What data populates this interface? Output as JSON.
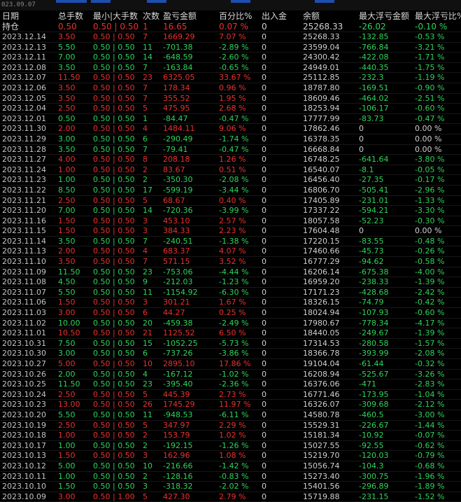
{
  "app": {
    "top_date": "023.09.07",
    "colors": {
      "up": "#e8322e",
      "down": "#2fd35a",
      "neutral": "#d0d0d0",
      "background": "#000000"
    }
  },
  "headers": [
    "日期",
    "总手数",
    "最小|大手数",
    "次数",
    "盈亏金额",
    "百分比%",
    "出入金",
    "余额",
    "最大浮亏金额",
    "最大浮亏比%"
  ],
  "holding": {
    "label": "持仓",
    "total": "0.50",
    "minmax": "0.50 | 0.50",
    "count": "1",
    "pnl": "16.65",
    "pct": "0.07 %",
    "flow": "0",
    "balance": "25268.33",
    "maxloss": "-26.02",
    "maxlosspct": "-0.10 %",
    "tone": "red"
  },
  "rows": [
    {
      "date": "2023.12.14",
      "total": "3.50",
      "minmax": "0.50 | 0.50",
      "count": "7",
      "pnl": "1669.29",
      "pct": "7.07 %",
      "flow": "0",
      "balance": "25268.33",
      "maxloss": "-132.85",
      "maxlosspct": "-0.53 %",
      "tone": "red"
    },
    {
      "date": "2023.12.13",
      "total": "5.50",
      "minmax": "0.50 | 0.50",
      "count": "11",
      "pnl": "-701.38",
      "pct": "-2.89 %",
      "flow": "0",
      "balance": "23599.04",
      "maxloss": "-766.84",
      "maxlosspct": "-3.21 %",
      "tone": "green"
    },
    {
      "date": "2023.12.11",
      "total": "7.00",
      "minmax": "0.50 | 0.50",
      "count": "14",
      "pnl": "-648.59",
      "pct": "-2.60 %",
      "flow": "0",
      "balance": "24300.42",
      "maxloss": "-422.08",
      "maxlosspct": "-1.71 %",
      "tone": "green"
    },
    {
      "date": "2023.12.08",
      "total": "3.50",
      "minmax": "0.50 | 0.50",
      "count": "7",
      "pnl": "-163.84",
      "pct": "-0.65 %",
      "flow": "0",
      "balance": "24949.01",
      "maxloss": "-440.35",
      "maxlosspct": "-1.75 %",
      "tone": "green"
    },
    {
      "date": "2023.12.07",
      "total": "11.50",
      "minmax": "0.50 | 0.50",
      "count": "23",
      "pnl": "6325.05",
      "pct": "33.67 %",
      "flow": "0",
      "balance": "25112.85",
      "maxloss": "-232.3",
      "maxlosspct": "-1.19 %",
      "tone": "red"
    },
    {
      "date": "2023.12.06",
      "total": "3.50",
      "minmax": "0.50 | 0.50",
      "count": "7",
      "pnl": "178.34",
      "pct": "0.96 %",
      "flow": "0",
      "balance": "18787.80",
      "maxloss": "-169.51",
      "maxlosspct": "-0.90 %",
      "tone": "red"
    },
    {
      "date": "2023.12.05",
      "total": "3.50",
      "minmax": "0.50 | 0.50",
      "count": "7",
      "pnl": "355.52",
      "pct": "1.95 %",
      "flow": "0",
      "balance": "18609.46",
      "maxloss": "-464.02",
      "maxlosspct": "-2.51 %",
      "tone": "red"
    },
    {
      "date": "2023.12.04",
      "total": "2.50",
      "minmax": "0.50 | 0.50",
      "count": "5",
      "pnl": "475.95",
      "pct": "2.68 %",
      "flow": "0",
      "balance": "18253.94",
      "maxloss": "-106.17",
      "maxlosspct": "-0.60 %",
      "tone": "red"
    },
    {
      "date": "2023.12.01",
      "total": "0.50",
      "minmax": "0.50 | 0.50",
      "count": "1",
      "pnl": "-84.47",
      "pct": "-0.47 %",
      "flow": "0",
      "balance": "17777.99",
      "maxloss": "-83.73",
      "maxlosspct": "-0.47 %",
      "tone": "green"
    },
    {
      "date": "2023.11.30",
      "total": "2.00",
      "minmax": "0.50 | 0.50",
      "count": "4",
      "pnl": "1484.11",
      "pct": "9.06 %",
      "flow": "0",
      "balance": "17862.46",
      "maxloss": "0",
      "maxlosspct": "0.00 %",
      "tone": "red"
    },
    {
      "date": "2023.11.29",
      "total": "3.00",
      "minmax": "0.50 | 0.50",
      "count": "6",
      "pnl": "-290.49",
      "pct": "-1.74 %",
      "flow": "0",
      "balance": "16378.35",
      "maxloss": "0",
      "maxlosspct": "0.00 %",
      "tone": "green"
    },
    {
      "date": "2023.11.28",
      "total": "3.50",
      "minmax": "0.50 | 0.50",
      "count": "7",
      "pnl": "-79.41",
      "pct": "-0.47 %",
      "flow": "0",
      "balance": "16668.84",
      "maxloss": "0",
      "maxlosspct": "0.00 %",
      "tone": "green"
    },
    {
      "date": "2023.11.27",
      "total": "4.00",
      "minmax": "0.50 | 0.50",
      "count": "8",
      "pnl": "208.18",
      "pct": "1.26 %",
      "flow": "0",
      "balance": "16748.25",
      "maxloss": "-641.64",
      "maxlosspct": "-3.80 %",
      "tone": "red"
    },
    {
      "date": "2023.11.24",
      "total": "1.00",
      "minmax": "0.50 | 0.50",
      "count": "2",
      "pnl": "83.67",
      "pct": "0.51 %",
      "flow": "0",
      "balance": "16540.07",
      "maxloss": "-8.1",
      "maxlosspct": "-0.05 %",
      "tone": "red"
    },
    {
      "date": "2023.11.23",
      "total": "1.00",
      "minmax": "0.50 | 0.50",
      "count": "2",
      "pnl": "-350.30",
      "pct": "-2.08 %",
      "flow": "0",
      "balance": "16456.40",
      "maxloss": "-27.35",
      "maxlosspct": "-0.17 %",
      "tone": "green"
    },
    {
      "date": "2023.11.22",
      "total": "8.50",
      "minmax": "0.50 | 0.50",
      "count": "17",
      "pnl": "-599.19",
      "pct": "-3.44 %",
      "flow": "0",
      "balance": "16806.70",
      "maxloss": "-505.41",
      "maxlosspct": "-2.96 %",
      "tone": "green"
    },
    {
      "date": "2023.11.21",
      "total": "2.50",
      "minmax": "0.50 | 0.50",
      "count": "5",
      "pnl": "68.67",
      "pct": "0.40 %",
      "flow": "0",
      "balance": "17405.89",
      "maxloss": "-231.01",
      "maxlosspct": "-1.33 %",
      "tone": "red"
    },
    {
      "date": "2023.11.20",
      "total": "7.00",
      "minmax": "0.50 | 0.50",
      "count": "14",
      "pnl": "-720.36",
      "pct": "-3.99 %",
      "flow": "0",
      "balance": "17337.22",
      "maxloss": "-594.21",
      "maxlosspct": "-3.30 %",
      "tone": "green"
    },
    {
      "date": "2023.11.16",
      "total": "1.50",
      "minmax": "0.50 | 0.50",
      "count": "3",
      "pnl": "453.10",
      "pct": "2.57 %",
      "flow": "0",
      "balance": "18057.58",
      "maxloss": "-52.23",
      "maxlosspct": "-0.30 %",
      "tone": "red"
    },
    {
      "date": "2023.11.15",
      "total": "1.50",
      "minmax": "0.50 | 0.50",
      "count": "3",
      "pnl": "384.33",
      "pct": "2.23 %",
      "flow": "0",
      "balance": "17604.48",
      "maxloss": "0",
      "maxlosspct": "0.00 %",
      "tone": "red"
    },
    {
      "date": "2023.11.14",
      "total": "3.50",
      "minmax": "0.50 | 0.50",
      "count": "7",
      "pnl": "-240.51",
      "pct": "-1.38 %",
      "flow": "0",
      "balance": "17220.15",
      "maxloss": "-83.55",
      "maxlosspct": "-0.48 %",
      "tone": "green"
    },
    {
      "date": "2023.11.13",
      "total": "2.00",
      "minmax": "0.50 | 0.50",
      "count": "4",
      "pnl": "683.37",
      "pct": "4.07 %",
      "flow": "0",
      "balance": "17460.66",
      "maxloss": "-45.73",
      "maxlosspct": "-0.26 %",
      "tone": "red"
    },
    {
      "date": "2023.11.10",
      "total": "3.50",
      "minmax": "0.50 | 0.50",
      "count": "7",
      "pnl": "571.15",
      "pct": "3.52 %",
      "flow": "0",
      "balance": "16777.29",
      "maxloss": "-94.62",
      "maxlosspct": "-0.58 %",
      "tone": "red"
    },
    {
      "date": "2023.11.09",
      "total": "11.50",
      "minmax": "0.50 | 0.50",
      "count": "23",
      "pnl": "-753.06",
      "pct": "-4.44 %",
      "flow": "0",
      "balance": "16206.14",
      "maxloss": "-675.38",
      "maxlosspct": "-4.00 %",
      "tone": "green"
    },
    {
      "date": "2023.11.08",
      "total": "4.50",
      "minmax": "0.50 | 0.50",
      "count": "9",
      "pnl": "-212.03",
      "pct": "-1.23 %",
      "flow": "0",
      "balance": "16959.20",
      "maxloss": "-238.33",
      "maxlosspct": "-1.39 %",
      "tone": "green"
    },
    {
      "date": "2023.11.07",
      "total": "5.50",
      "minmax": "0.50 | 0.50",
      "count": "11",
      "pnl": "-1154.92",
      "pct": "-6.30 %",
      "flow": "0",
      "balance": "17171.23",
      "maxloss": "-428.68",
      "maxlosspct": "-2.42 %",
      "tone": "green"
    },
    {
      "date": "2023.11.06",
      "total": "1.50",
      "minmax": "0.50 | 0.50",
      "count": "3",
      "pnl": "301.21",
      "pct": "1.67 %",
      "flow": "0",
      "balance": "18326.15",
      "maxloss": "-74.79",
      "maxlosspct": "-0.42 %",
      "tone": "red"
    },
    {
      "date": "2023.11.03",
      "total": "3.00",
      "minmax": "0.50 | 0.50",
      "count": "6",
      "pnl": "44.27",
      "pct": "0.25 %",
      "flow": "0",
      "balance": "18024.94",
      "maxloss": "-107.93",
      "maxlosspct": "-0.60 %",
      "tone": "red"
    },
    {
      "date": "2023.11.02",
      "total": "10.00",
      "minmax": "0.50 | 0.50",
      "count": "20",
      "pnl": "-459.38",
      "pct": "-2.49 %",
      "flow": "0",
      "balance": "17980.67",
      "maxloss": "-778.34",
      "maxlosspct": "-4.17 %",
      "tone": "green"
    },
    {
      "date": "2023.11.01",
      "total": "10.50",
      "minmax": "0.50 | 0.50",
      "count": "21",
      "pnl": "1125.52",
      "pct": "6.50 %",
      "flow": "0",
      "balance": "18440.05",
      "maxloss": "-249.67",
      "maxlosspct": "-1.39 %",
      "tone": "red"
    },
    {
      "date": "2023.10.31",
      "total": "7.50",
      "minmax": "0.50 | 0.50",
      "count": "15",
      "pnl": "-1052.25",
      "pct": "-5.73 %",
      "flow": "0",
      "balance": "17314.53",
      "maxloss": "-280.58",
      "maxlosspct": "-1.57 %",
      "tone": "green"
    },
    {
      "date": "2023.10.30",
      "total": "3.00",
      "minmax": "0.50 | 0.50",
      "count": "6",
      "pnl": "-737.26",
      "pct": "-3.86 %",
      "flow": "0",
      "balance": "18366.78",
      "maxloss": "-393.99",
      "maxlosspct": "-2.08 %",
      "tone": "green"
    },
    {
      "date": "2023.10.27",
      "total": "5.00",
      "minmax": "0.50 | 0.50",
      "count": "10",
      "pnl": "2895.10",
      "pct": "17.86 %",
      "flow": "0",
      "balance": "19104.04",
      "maxloss": "-61.44",
      "maxlosspct": "-0.32 %",
      "tone": "red"
    },
    {
      "date": "2023.10.26",
      "total": "2.00",
      "minmax": "0.50 | 0.50",
      "count": "4",
      "pnl": "-167.12",
      "pct": "-1.02 %",
      "flow": "0",
      "balance": "16208.94",
      "maxloss": "-525.67",
      "maxlosspct": "-3.26 %",
      "tone": "green"
    },
    {
      "date": "2023.10.25",
      "total": "11.50",
      "minmax": "0.50 | 0.50",
      "count": "23",
      "pnl": "-395.40",
      "pct": "-2.36 %",
      "flow": "0",
      "balance": "16376.06",
      "maxloss": "-471",
      "maxlosspct": "-2.83 %",
      "tone": "green"
    },
    {
      "date": "2023.10.24",
      "total": "2.50",
      "minmax": "0.50 | 0.50",
      "count": "5",
      "pnl": "445.39",
      "pct": "2.73 %",
      "flow": "0",
      "balance": "16771.46",
      "maxloss": "-173.95",
      "maxlosspct": "-1.04 %",
      "tone": "red"
    },
    {
      "date": "2023.10.23",
      "total": "13.00",
      "minmax": "0.50 | 0.50",
      "count": "26",
      "pnl": "1745.29",
      "pct": "11.97 %",
      "flow": "0",
      "balance": "16326.07",
      "maxloss": "-309.68",
      "maxlosspct": "-2.12 %",
      "tone": "red"
    },
    {
      "date": "2023.10.20",
      "total": "5.50",
      "minmax": "0.50 | 0.50",
      "count": "11",
      "pnl": "-948.53",
      "pct": "-6.11 %",
      "flow": "0",
      "balance": "14580.78",
      "maxloss": "-460.5",
      "maxlosspct": "-3.00 %",
      "tone": "green"
    },
    {
      "date": "2023.10.19",
      "total": "2.50",
      "minmax": "0.50 | 0.50",
      "count": "5",
      "pnl": "347.97",
      "pct": "2.29 %",
      "flow": "0",
      "balance": "15529.31",
      "maxloss": "-226.67",
      "maxlosspct": "-1.44 %",
      "tone": "red"
    },
    {
      "date": "2023.10.18",
      "total": "1.00",
      "minmax": "0.50 | 0.50",
      "count": "2",
      "pnl": "153.79",
      "pct": "1.02 %",
      "flow": "0",
      "balance": "15181.34",
      "maxloss": "-10.92",
      "maxlosspct": "-0.07 %",
      "tone": "red"
    },
    {
      "date": "2023.10.17",
      "total": "1.00",
      "minmax": "0.50 | 0.50",
      "count": "2",
      "pnl": "-192.15",
      "pct": "-1.26 %",
      "flow": "0",
      "balance": "15027.55",
      "maxloss": "-92.55",
      "maxlosspct": "-0.62 %",
      "tone": "green"
    },
    {
      "date": "2023.10.13",
      "total": "1.50",
      "minmax": "0.50 | 0.50",
      "count": "3",
      "pnl": "162.96",
      "pct": "1.08 %",
      "flow": "0",
      "balance": "15219.70",
      "maxloss": "-120.03",
      "maxlosspct": "-0.79 %",
      "tone": "red"
    },
    {
      "date": "2023.10.12",
      "total": "5.00",
      "minmax": "0.50 | 0.50",
      "count": "10",
      "pnl": "-216.66",
      "pct": "-1.42 %",
      "flow": "0",
      "balance": "15056.74",
      "maxloss": "-104.3",
      "maxlosspct": "-0.68 %",
      "tone": "green"
    },
    {
      "date": "2023.10.11",
      "total": "1.00",
      "minmax": "0.50 | 0.50",
      "count": "2",
      "pnl": "-128.16",
      "pct": "-0.83 %",
      "flow": "0",
      "balance": "15273.40",
      "maxloss": "-300.75",
      "maxlosspct": "-1.96 %",
      "tone": "green"
    },
    {
      "date": "2023.10.10",
      "total": "1.50",
      "minmax": "0.50 | 0.50",
      "count": "3",
      "pnl": "-318.32",
      "pct": "-2.02 %",
      "flow": "0",
      "balance": "15401.56",
      "maxloss": "-296.89",
      "maxlosspct": "-1.89 %",
      "tone": "green"
    },
    {
      "date": "2023.10.09",
      "total": "3.00",
      "minmax": "0.50 | 1.00",
      "count": "5",
      "pnl": "427.30",
      "pct": "2.79 %",
      "flow": "0",
      "balance": "15719.88",
      "maxloss": "-231.15",
      "maxlosspct": "-1.52 %",
      "tone": "red"
    }
  ]
}
